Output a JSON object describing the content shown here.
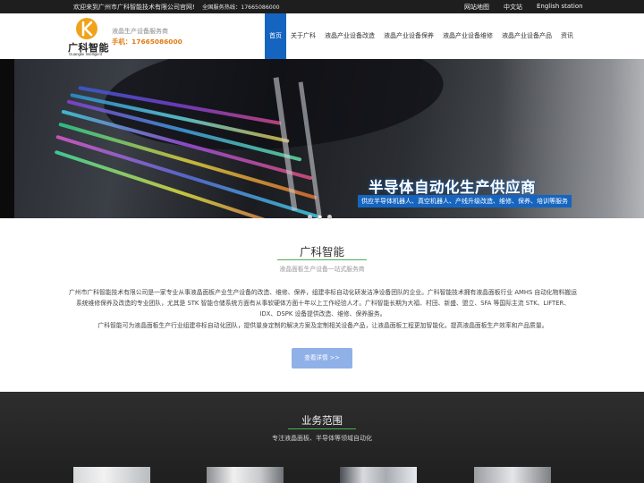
{
  "topbar": {
    "welcome": "欢迎来到广州市广科智能技术有限公司官网!",
    "hotline": "全国服务热线：17665086000",
    "links": [
      "网站地图",
      "中文站",
      "English station"
    ]
  },
  "header": {
    "logo_name": "广科智能",
    "logo_en": "Guangke Intelligent",
    "tagline": "液晶生产设备服务商",
    "phone": "手机：17665086000"
  },
  "nav": {
    "items": [
      "首页",
      "关于广科",
      "液晶产业设备改造",
      "液晶产业设备保养",
      "液晶产业设备维修",
      "液晶产业设备产品",
      "资讯"
    ],
    "active_index": 0
  },
  "banner": {
    "title": "半导体自动化生产供应商",
    "subtitle": "供应半导体机器人、真空机器人、产线升级改造、维修、保养、培训等服务",
    "slide_count": 3,
    "active_slide": 1
  },
  "about": {
    "title": "广科智能",
    "subtitle": "液晶面板生产设备一站式服务商",
    "paragraphs": [
      "广州市广科智能技术有限公司是一家专业从事液晶面板产业生产设备的改造、维修、保养，组建非标自动化研发洁净设备团队的企业。广科智能技术拥有液晶面板行业 AMHS 自动化物料搬运系统维修保养及改造的专业团队，尤其是 STK 智能仓储系统方面有从事软硬体方面十年以上工作经验人才。广科智能长期为大福、村田、新盛、盟立、SFA 等国际主流 STK、LIFTER、IDX、DSPK 设备提供改造、维修、保养服务。",
      "广科智能可为液晶面板生产行业组建非标自动化团队，提供量身定制的解决方案及定制相关设备产品，让液晶面板工程更加智能化，提高液晶面板生产效率和产品质量。"
    ],
    "more_label": "查看详情 >>"
  },
  "services": {
    "title": "业务范围",
    "subtitle": "专注液晶面板、半导体等领域自动化"
  },
  "colors": {
    "accent": "#1565c0",
    "phone": "#e07b13",
    "divider": "#4caf50",
    "button": "#90b0e8"
  }
}
